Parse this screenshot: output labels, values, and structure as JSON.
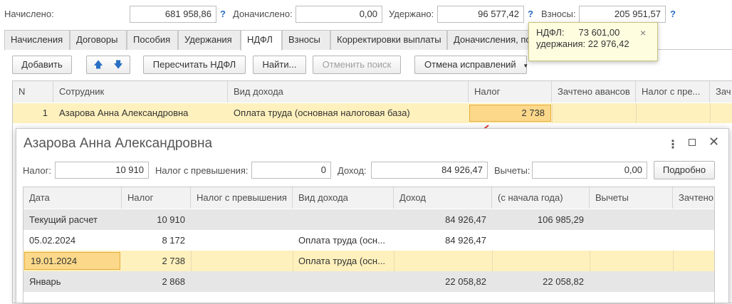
{
  "summary": {
    "accrued_label": "Начислено:",
    "accrued_value": "681 958,86",
    "additional_label": "Доначислено:",
    "additional_value": "0,00",
    "withheld_label": "Удержано:",
    "withheld_value": "96 577,42",
    "contributions_label": "Взносы:",
    "contributions_value": "205 951,57",
    "help_symbol": "?"
  },
  "tabs": [
    {
      "label": "Начисления"
    },
    {
      "label": "Договоры"
    },
    {
      "label": "Пособия"
    },
    {
      "label": "Удержания"
    },
    {
      "label": "НДФЛ"
    },
    {
      "label": "Взносы"
    },
    {
      "label": "Корректировки выплаты"
    },
    {
      "label": "Доначисления, по"
    }
  ],
  "toolbar": {
    "add": "Добавить",
    "recalc": "Пересчитать НДФЛ",
    "find": "Найти...",
    "cancel_search": "Отменить поиск",
    "cancel_corrections": "Отмена исправлений"
  },
  "main_table": {
    "headers": [
      "N",
      "Сотрудник",
      "Вид дохода",
      "Налог",
      "Зачтено авансов",
      "Налог с пре...",
      "Зач"
    ],
    "row": {
      "n": "1",
      "employee": "Азарова Анна Александровна",
      "income_type": "Оплата труда (основная налоговая база)",
      "tax": "2 738"
    }
  },
  "tooltip": {
    "line1_label": "НДФЛ:",
    "line1_value": "73 601,00",
    "line2_label": "удержания:",
    "line2_value": "22 976,42",
    "close": "×"
  },
  "window": {
    "title": "Азарова Анна Александровна",
    "tax_label": "Налог:",
    "tax_value": "10 910",
    "excess_label": "Налог с превышения:",
    "excess_value": "0",
    "income_label": "Доход:",
    "income_value": "84 926,47",
    "deductions_label": "Вычеты:",
    "deductions_value": "0,00",
    "details_button": "Подробно",
    "headers": [
      "Дата",
      "Налог",
      "Налог с превышения",
      "Вид дохода",
      "Доход",
      "(с начала года)",
      "Вычеты",
      "Зачтено"
    ],
    "rows": [
      {
        "date": "Текущий расчет",
        "tax": "10 910",
        "excess": "",
        "income_type": "",
        "income": "84 926,47",
        "ytd": "106 985,29",
        "deductions": "",
        "credited": ""
      },
      {
        "date": "05.02.2024",
        "tax": "8 172",
        "excess": "",
        "income_type": "Оплата труда (осн...",
        "income": "84 926,47",
        "ytd": "",
        "deductions": "",
        "credited": ""
      },
      {
        "date": "19.01.2024",
        "tax": "2 738",
        "excess": "",
        "income_type": "Оплата труда (осн...",
        "income": "",
        "ytd": "",
        "deductions": "",
        "credited": ""
      },
      {
        "date": "Январь",
        "tax": "2 868",
        "excess": "",
        "income_type": "",
        "income": "22 058,82",
        "ytd": "22 058,82",
        "deductions": "",
        "credited": ""
      }
    ]
  },
  "colors": {
    "selection": "#fff1bd",
    "selected_cell": "#fcd98a",
    "group_row": "#e6e6e6",
    "help": "#2a6fc4",
    "arrow": "#e2372a"
  }
}
